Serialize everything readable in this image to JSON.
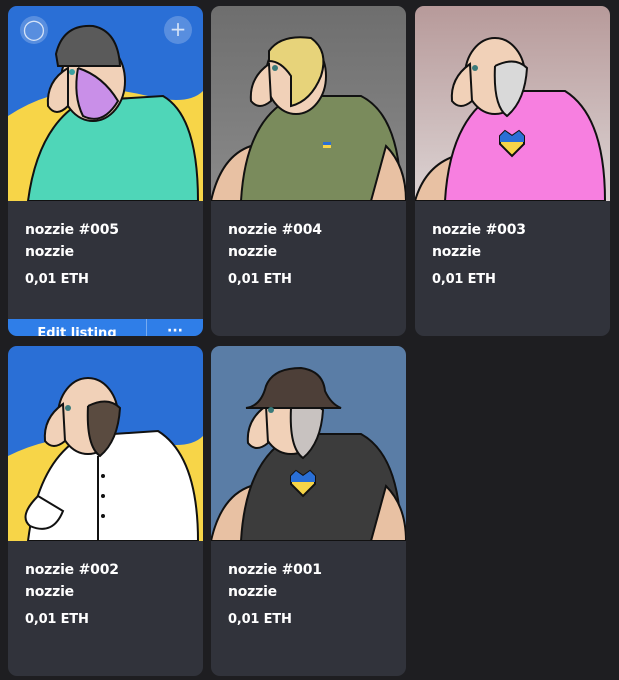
{
  "cards": [
    {
      "title": "nozzie #005",
      "collection": "nozzie",
      "price": "0,01 ETH",
      "image_icon": "nft-avatar-icon",
      "edit_label": "Edit listing",
      "more_label": "···",
      "overlay_left_icon": "cart-icon",
      "overlay_right_icon": "+",
      "palette": {
        "bg_top": "#2a6fd6",
        "bg_bottom": "#f7d548",
        "shirt": "#4fd6b8",
        "mask": "#c98fe8",
        "hat": "#5a5a5a"
      }
    },
    {
      "title": "nozzie #004",
      "collection": "nozzie",
      "price": "0,01 ETH",
      "image_icon": "nft-avatar-icon",
      "palette": {
        "bg": "#7a7a7a",
        "shirt": "#7a8b5c",
        "hair": "#e7d37a"
      }
    },
    {
      "title": "nozzie #003",
      "collection": "nozzie",
      "price": "0,01 ETH",
      "image_icon": "nft-avatar-icon",
      "palette": {
        "bg_top": "#b79a9a",
        "bg_bottom": "#d8cfd0",
        "shirt": "#f77fe0",
        "beard": "#d9d9d9"
      }
    },
    {
      "title": "nozzie #002",
      "collection": "nozzie",
      "price": "0,01 ETH",
      "image_icon": "nft-avatar-icon",
      "palette": {
        "bg_top": "#2a6fd6",
        "bg_bottom": "#f7d548",
        "shirt": "#ffffff",
        "beard": "#5a4b40"
      }
    },
    {
      "title": "nozzie #001",
      "collection": "nozzie",
      "price": "0,01 ETH",
      "image_icon": "nft-avatar-icon",
      "palette": {
        "bg": "#5a7da6",
        "shirt": "#3c3c3c",
        "hat": "#4d3f38",
        "beard": "#c8c2c0"
      }
    }
  ],
  "colors": {
    "page_bg": "#1e1e21",
    "card_bg": "#31333b",
    "accent": "#2f7ee8",
    "text": "#ffffff"
  }
}
